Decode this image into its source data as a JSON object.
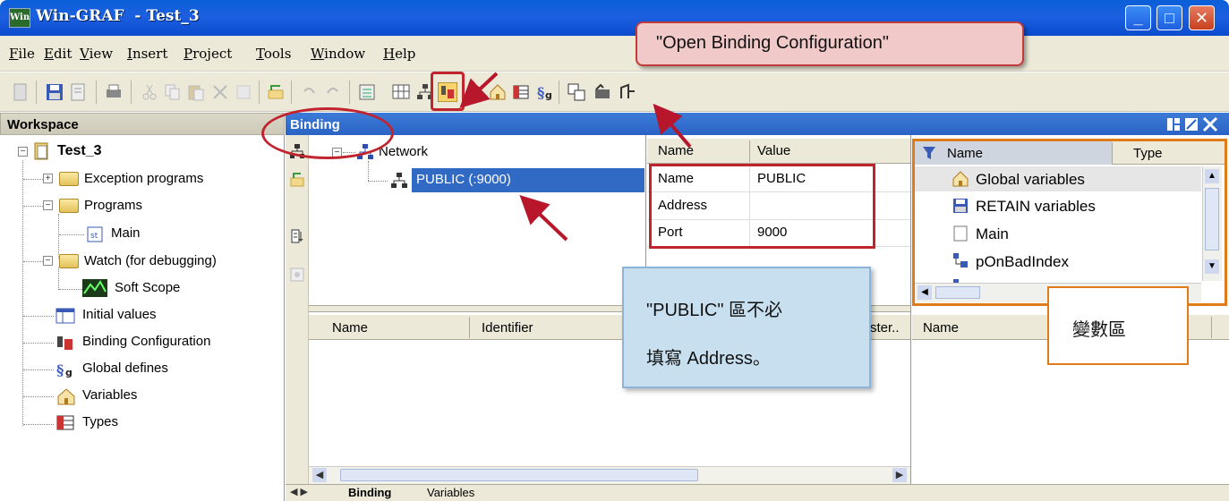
{
  "window": {
    "app_icon_text": "Win",
    "title": "Win-GRAF  - Test_3",
    "minimize": "_",
    "maximize": "□",
    "close": "✕"
  },
  "menu": [
    "File",
    "Edit",
    "View",
    "Insert",
    "Project",
    "Tools",
    "Window",
    "Help"
  ],
  "toolbar_icons": [
    "new-icon",
    "save-icon",
    "save-as-icon",
    "print-icon",
    "cut-icon",
    "copy-icon",
    "paste-icon",
    "delete-icon",
    "undo-all-icon",
    "compile-icon",
    "undo-icon",
    "redo-icon",
    "io-config-icon",
    "grid-icon",
    "network-icon",
    "binding-config-icon",
    "fieldbus-icon",
    "home-icon",
    "types-icon",
    "global-defines-icon",
    "windows-icon",
    "debug-icon",
    "resource-icon"
  ],
  "callouts": {
    "open_binding": "\"Open Binding Configuration\"",
    "public_note_line1": "\"PUBLIC\"  區不必",
    "public_note_line2": "填寫  Address。",
    "variable_area": "變數區"
  },
  "workspace": {
    "title": "Workspace",
    "project": "Test_3",
    "items": [
      {
        "label": "Exception programs",
        "icon": "folder-icon"
      },
      {
        "label": "Programs",
        "icon": "folder-icon"
      },
      {
        "label": "Main",
        "icon": "program-icon"
      },
      {
        "label": "Watch (for debugging)",
        "icon": "folder-icon"
      },
      {
        "label": "Soft Scope",
        "icon": "scope-icon"
      },
      {
        "label": "Initial values",
        "icon": "table-icon"
      },
      {
        "label": "Binding Configuration",
        "icon": "binding-icon"
      },
      {
        "label": "Global defines",
        "icon": "defines-icon"
      },
      {
        "label": "Variables",
        "icon": "variables-icon"
      },
      {
        "label": "Types",
        "icon": "types-icon"
      }
    ]
  },
  "binding": {
    "title": "Binding",
    "tree_root": "Network",
    "tree_child": "PUBLIC (:9000)",
    "props_headers": [
      "Name",
      "Value"
    ],
    "props": [
      {
        "name": "Name",
        "value": "PUBLIC"
      },
      {
        "name": "Address",
        "value": ""
      },
      {
        "name": "Port",
        "value": "9000"
      }
    ],
    "list_headers": [
      "Name",
      "Identifier",
      "ster.."
    ],
    "tabs": [
      "Binding",
      "Variables"
    ]
  },
  "variables_panel": {
    "headers": [
      "Name",
      "Type"
    ],
    "items": [
      {
        "label": "Global variables",
        "icon": "home-icon"
      },
      {
        "label": "RETAIN variables",
        "icon": "save-icon"
      },
      {
        "label": "Main",
        "icon": "page-icon"
      },
      {
        "label": "pOnBadIndex",
        "icon": "function-block-icon"
      }
    ],
    "list_header": "Name"
  }
}
